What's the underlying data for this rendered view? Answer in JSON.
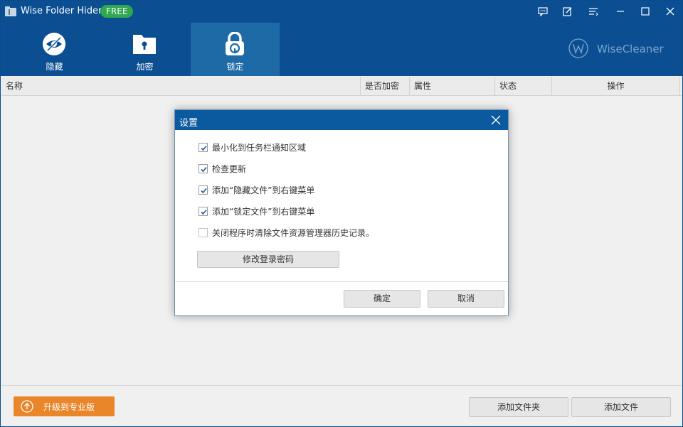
{
  "app": {
    "title": "Wise Folder Hider",
    "badge": "FREE"
  },
  "tabs": [
    {
      "label": "隐藏",
      "icon": "eye-slash-icon",
      "active": false
    },
    {
      "label": "加密",
      "icon": "lock-folder-icon",
      "active": false
    },
    {
      "label": "锁定",
      "icon": "padlock-icon",
      "active": true
    }
  ],
  "brand": {
    "name": "WiseCleaner"
  },
  "table": {
    "headers": [
      "名称",
      "是否加密",
      "属性",
      "状态",
      "操作"
    ]
  },
  "footer": {
    "upgrade_label": "升级到专业版",
    "add_folder_label": "添加文件夹",
    "add_file_label": "添加文件"
  },
  "dialog": {
    "title": "设置",
    "options": [
      {
        "label": "最小化到任务栏通知区域",
        "checked": true
      },
      {
        "label": "检查更新",
        "checked": true
      },
      {
        "label": "添加“隐藏文件”到右键菜单",
        "checked": true
      },
      {
        "label": "添加“锁定文件”到右键菜单",
        "checked": true
      },
      {
        "label": "关闭程序时清除文件资源管理器历史记录。",
        "checked": false
      }
    ],
    "change_password_label": "修改登录密码",
    "ok_label": "确定",
    "cancel_label": "取消"
  },
  "colors": {
    "header": "#0b4f92",
    "active_tab": "#1d6aa7",
    "badge": "#2fa84f",
    "upgrade": "#e9862a"
  }
}
